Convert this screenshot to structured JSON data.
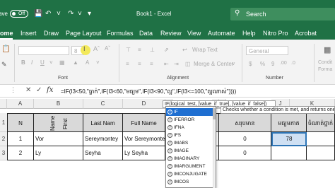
{
  "titlebar": {
    "autosave_label": "ave",
    "toggle_text": "Off",
    "doc_title": "Book1 - Excel",
    "search_placeholder": "Search"
  },
  "tabs": [
    "ome",
    "Insert",
    "Draw",
    "Page Layout",
    "Formulas",
    "Data",
    "Review",
    "View",
    "Automate",
    "Help",
    "Nitro Pro",
    "Acrobat"
  ],
  "ribbon": {
    "font_size_value": "8",
    "wrap_text": "Wrap Text",
    "number_format": "General",
    "merge_center": "Merge & Center",
    "conditional": "Condit Forma",
    "groups": {
      "font": "Font",
      "alignment": "Alignment",
      "number": "Number"
    },
    "colors": {
      "ribbon_bg": "#f3f3f3",
      "brand": "#1f7145"
    }
  },
  "formula_bar": {
    "formula": "=IF(I3<50,\"ធ្លាក់\",IF(I3<60,\"មធ្យម\",IF(I3<90,\"ល្អ\",IF(I3<=100,\"ល្អណាស់\"))))"
  },
  "grid": {
    "columns": [
      "A",
      "B",
      "C",
      "D",
      "E",
      "F",
      "G",
      "J",
      "K"
    ],
    "rows": [
      "1",
      "2",
      "3"
    ],
    "headers": {
      "n": "N",
      "name": "Name",
      "first": "First",
      "last_name": "Last Nam",
      "full_name": "Full Name",
      "kh_total": "សរុបមាន",
      "kh_avg": "មធ្យមភាគ",
      "kh_grade": "ចំណាត់ថ្នាក់"
    },
    "data": [
      {
        "n": "1",
        "first": "Vor",
        "last": "Sereymontey",
        "full": "Vor Sereymontey",
        "total": "0",
        "avg": "78"
      },
      {
        "n": "2",
        "first": "Ly",
        "last": "Seyha",
        "full": "Ly Seyha",
        "total": "0",
        "avg": ""
      }
    ]
  },
  "tooltip": {
    "syntax": "IF(logical_test, [value_if_true], [value_if_false])",
    "description": "Checks whether a condition is met, and returns one"
  },
  "autocomplete": [
    "IF",
    "IFERROR",
    "IFNA",
    "IFS",
    "IMABS",
    "IMAGE",
    "IMAGINARY",
    "IMARGUMENT",
    "IMCONJUGATE",
    "IMCOS"
  ]
}
